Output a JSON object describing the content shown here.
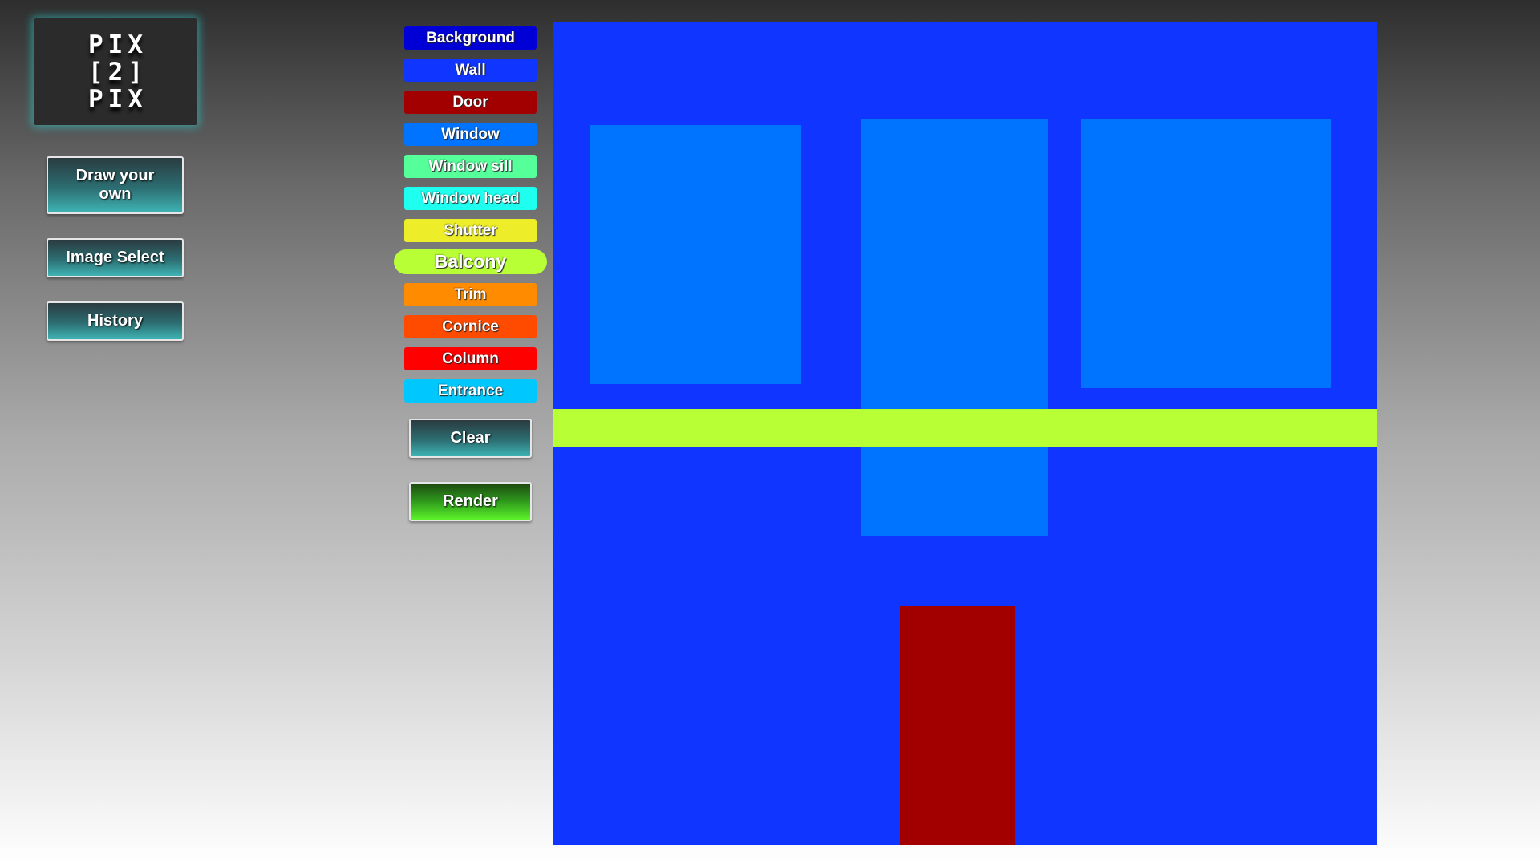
{
  "logo": {
    "line1": "PIX",
    "line2": "[2]",
    "line3": "PIX"
  },
  "nav": {
    "draw_label": "Draw your own",
    "image_select_label": "Image Select",
    "history_label": "History"
  },
  "labels": [
    {
      "label": "Background",
      "color": "#0000d6"
    },
    {
      "label": "Wall",
      "color": "#0f35ff"
    },
    {
      "label": "Door",
      "color": "#a20000"
    },
    {
      "label": "Window",
      "color": "#0074ff"
    },
    {
      "label": "Window sill",
      "color": "#55ff9a"
    },
    {
      "label": "Window head",
      "color": "#1ffff0"
    },
    {
      "label": "Shutter",
      "color": "#eded2a"
    },
    {
      "label": "Balcony",
      "color": "#b8ff36",
      "selected": true
    },
    {
      "label": "Trim",
      "color": "#ff8c00"
    },
    {
      "label": "Cornice",
      "color": "#ff4b00"
    },
    {
      "label": "Column",
      "color": "#ff0000"
    },
    {
      "label": "Entrance",
      "color": "#00c8ff"
    }
  ],
  "actions": {
    "clear_label": "Clear",
    "render_label": "Render"
  },
  "canvas": {
    "background": "#0f35ff",
    "shapes": [
      {
        "type": "Window",
        "color": "#0074ff"
      },
      {
        "type": "Window",
        "color": "#0074ff"
      },
      {
        "type": "Window",
        "color": "#0074ff"
      },
      {
        "type": "Balcony",
        "color": "#b8ff36"
      },
      {
        "type": "Door",
        "color": "#a20000"
      }
    ]
  }
}
